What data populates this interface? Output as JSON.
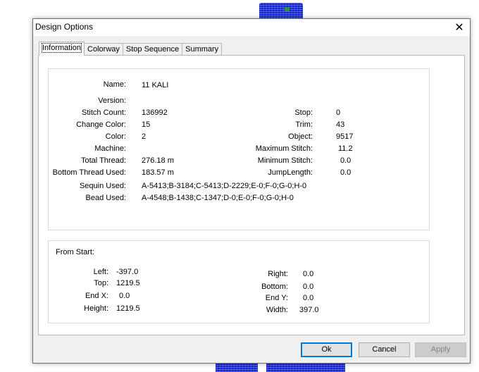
{
  "dialog": {
    "title": "Design Options",
    "close_glyph": "✕"
  },
  "tabs": [
    {
      "label": "Information",
      "active": true
    },
    {
      "label": "Colorway",
      "active": false
    },
    {
      "label": "Stop Sequence",
      "active": false
    },
    {
      "label": "Summary",
      "active": false
    }
  ],
  "info": {
    "name": {
      "label": "Name:",
      "value": "11 KALI"
    },
    "version": {
      "label": "Version:",
      "value": ""
    },
    "stitch_count": {
      "label": "Stitch Count:",
      "value": "136992"
    },
    "change_color": {
      "label": "Change Color:",
      "value": "15"
    },
    "color": {
      "label": "Color:",
      "value": "2"
    },
    "machine": {
      "label": "Machine:",
      "value": ""
    },
    "total_thread": {
      "label": "Total Thread:",
      "value": "276.18 m"
    },
    "bottom_thread": {
      "label": "Bottom Thread Used:",
      "value": "183.57 m"
    },
    "sequin_used": {
      "label": "Sequin Used:",
      "value": "A-5413;B-3184;C-5413;D-2229;E-0;F-0;G-0;H-0"
    },
    "bead_used": {
      "label": "Bead Used:",
      "value": "A-4548;B-1438;C-1347;D-0;E-0;F-0;G-0;H-0"
    },
    "stop": {
      "label": "Stop:",
      "value": "0"
    },
    "trim": {
      "label": "Trim:",
      "value": "43"
    },
    "object": {
      "label": "Object:",
      "value": "9517"
    },
    "max_stitch": {
      "label": "Maximum Stitch:",
      "value": "11.2"
    },
    "min_stitch": {
      "label": "Minimum Stitch:",
      "value": "0.0"
    },
    "jump_length": {
      "label": "JumpLength:",
      "value": "0.0"
    }
  },
  "from_start": {
    "heading": "From Start:",
    "left": {
      "label": "Left:",
      "value": "-397.0"
    },
    "top": {
      "label": "Top:",
      "value": "1219.5"
    },
    "end_x": {
      "label": "End X:",
      "value": "0.0"
    },
    "height": {
      "label": "Height:",
      "value": "1219.5"
    },
    "right": {
      "label": "Right:",
      "value": "0.0"
    },
    "bottom": {
      "label": "Bottom:",
      "value": "0.0"
    },
    "end_y": {
      "label": "End Y:",
      "value": "0.0"
    },
    "width": {
      "label": "Width:",
      "value": "397.0"
    }
  },
  "buttons": {
    "ok": "Ok",
    "cancel": "Cancel",
    "apply": "Apply"
  },
  "colors": {
    "embroidery_blue": "#1a2cc8",
    "accent": "#0078d7"
  }
}
